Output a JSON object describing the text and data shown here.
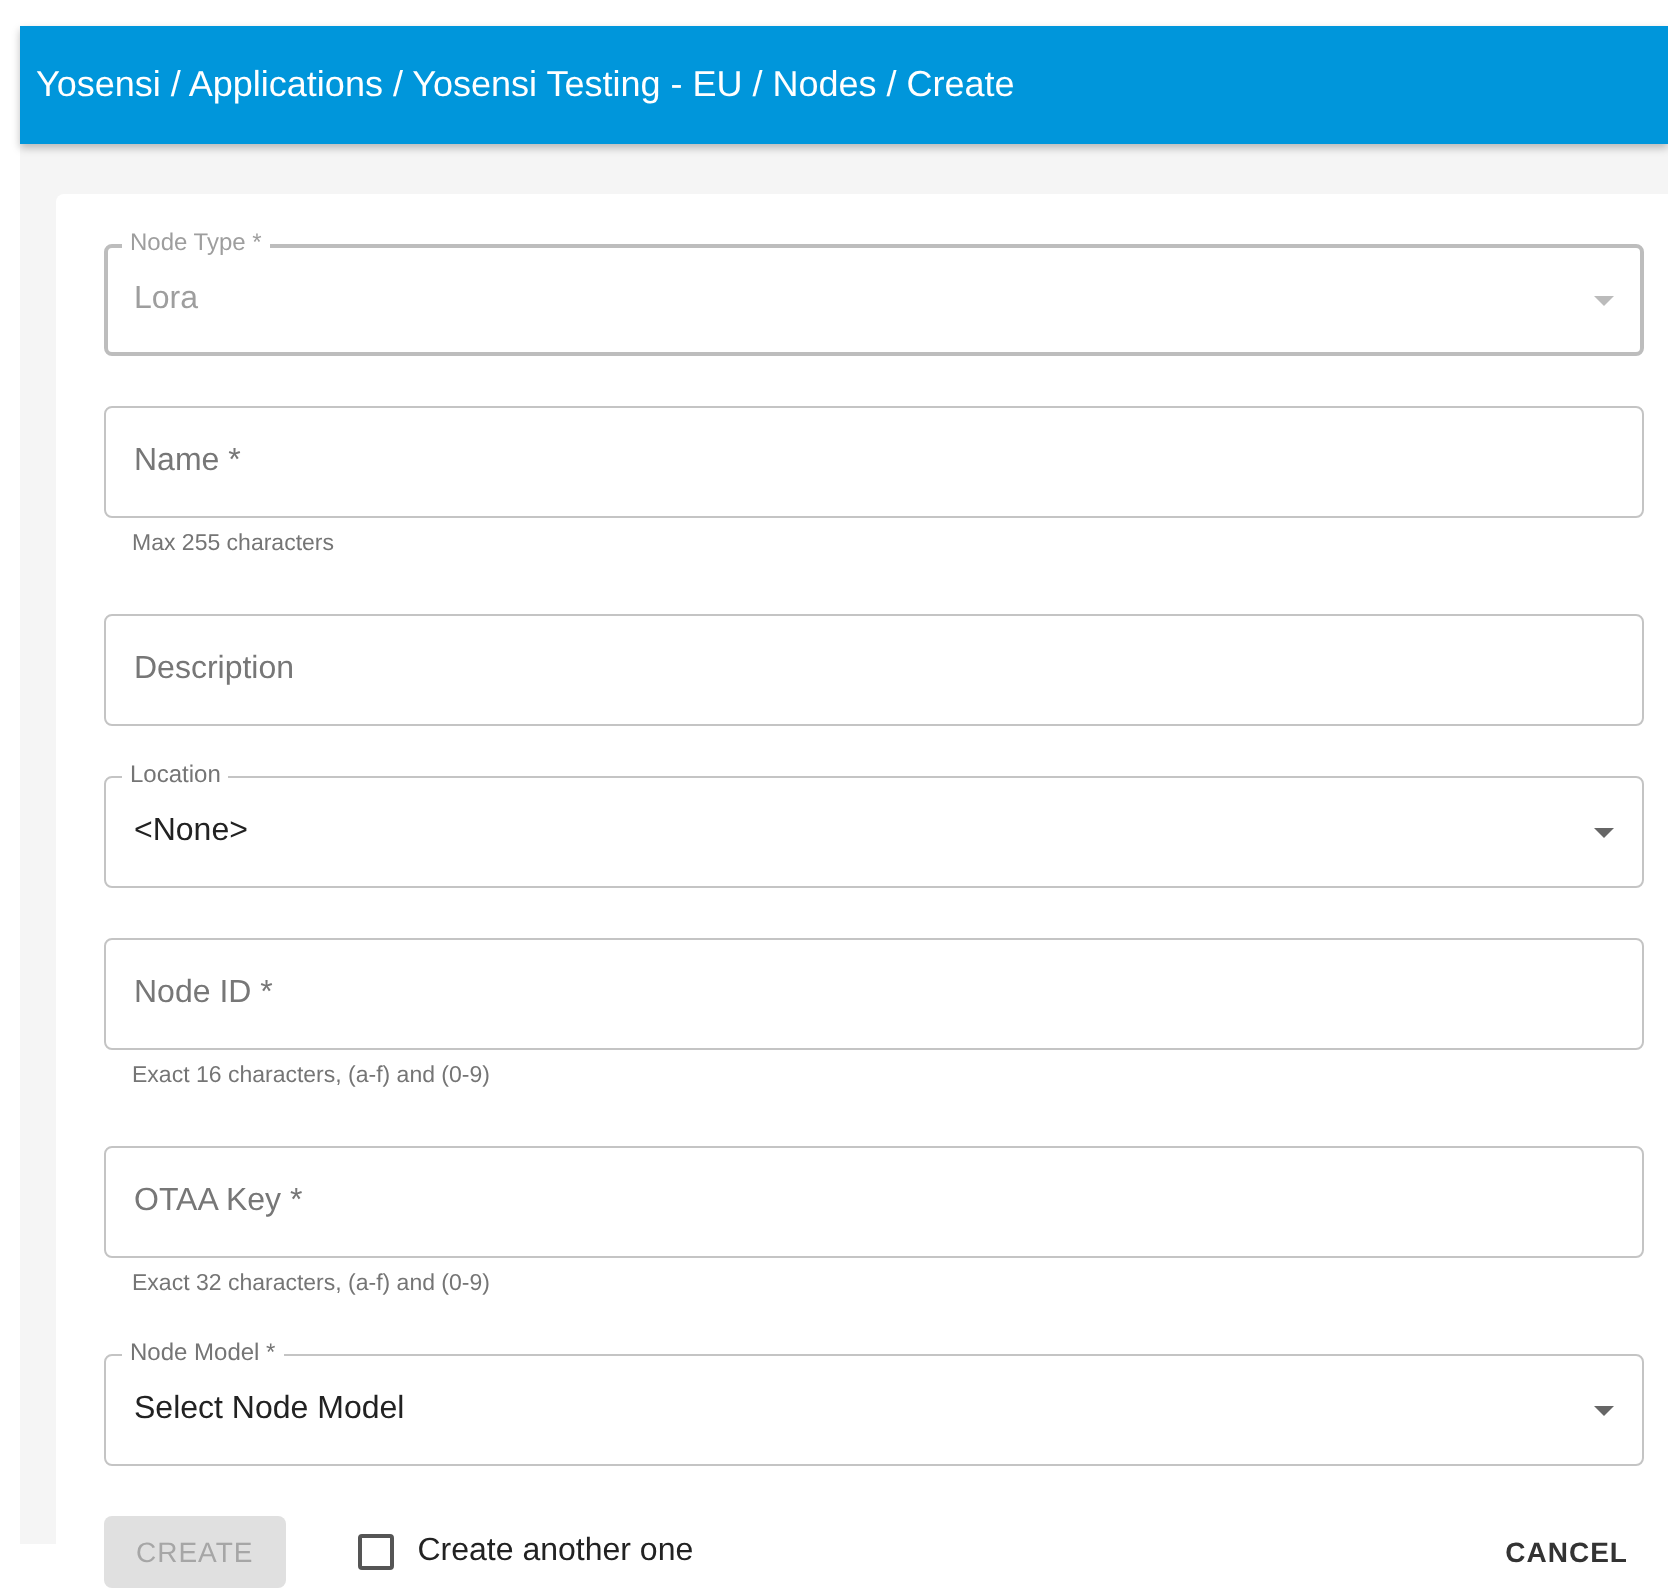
{
  "header": {
    "breadcrumb": "Yosensi / Applications / Yosensi Testing - EU / Nodes / Create"
  },
  "fields": [
    {
      "kind": "select",
      "label": "Node Type *",
      "value": "Lora",
      "disabled": true
    },
    {
      "kind": "text",
      "placeholder": "Name *",
      "helper": "Max 255 characters"
    },
    {
      "kind": "text",
      "placeholder": "Description"
    },
    {
      "kind": "select",
      "label": "Location",
      "value": "<None>",
      "disabled": false
    },
    {
      "kind": "text",
      "placeholder": "Node ID *",
      "helper": "Exact 16 characters, (a-f) and (0-9)"
    },
    {
      "kind": "text",
      "placeholder": "OTAA Key *",
      "helper": "Exact 32 characters, (a-f) and (0-9)"
    },
    {
      "kind": "select",
      "label": "Node Model *",
      "value": "Select Node Model",
      "disabled": false
    }
  ],
  "actions": {
    "create": {
      "label": "CREATE",
      "disabled": true
    },
    "another": {
      "label": "Create another one",
      "checked": false
    },
    "cancel": {
      "label": "CANCEL"
    }
  }
}
